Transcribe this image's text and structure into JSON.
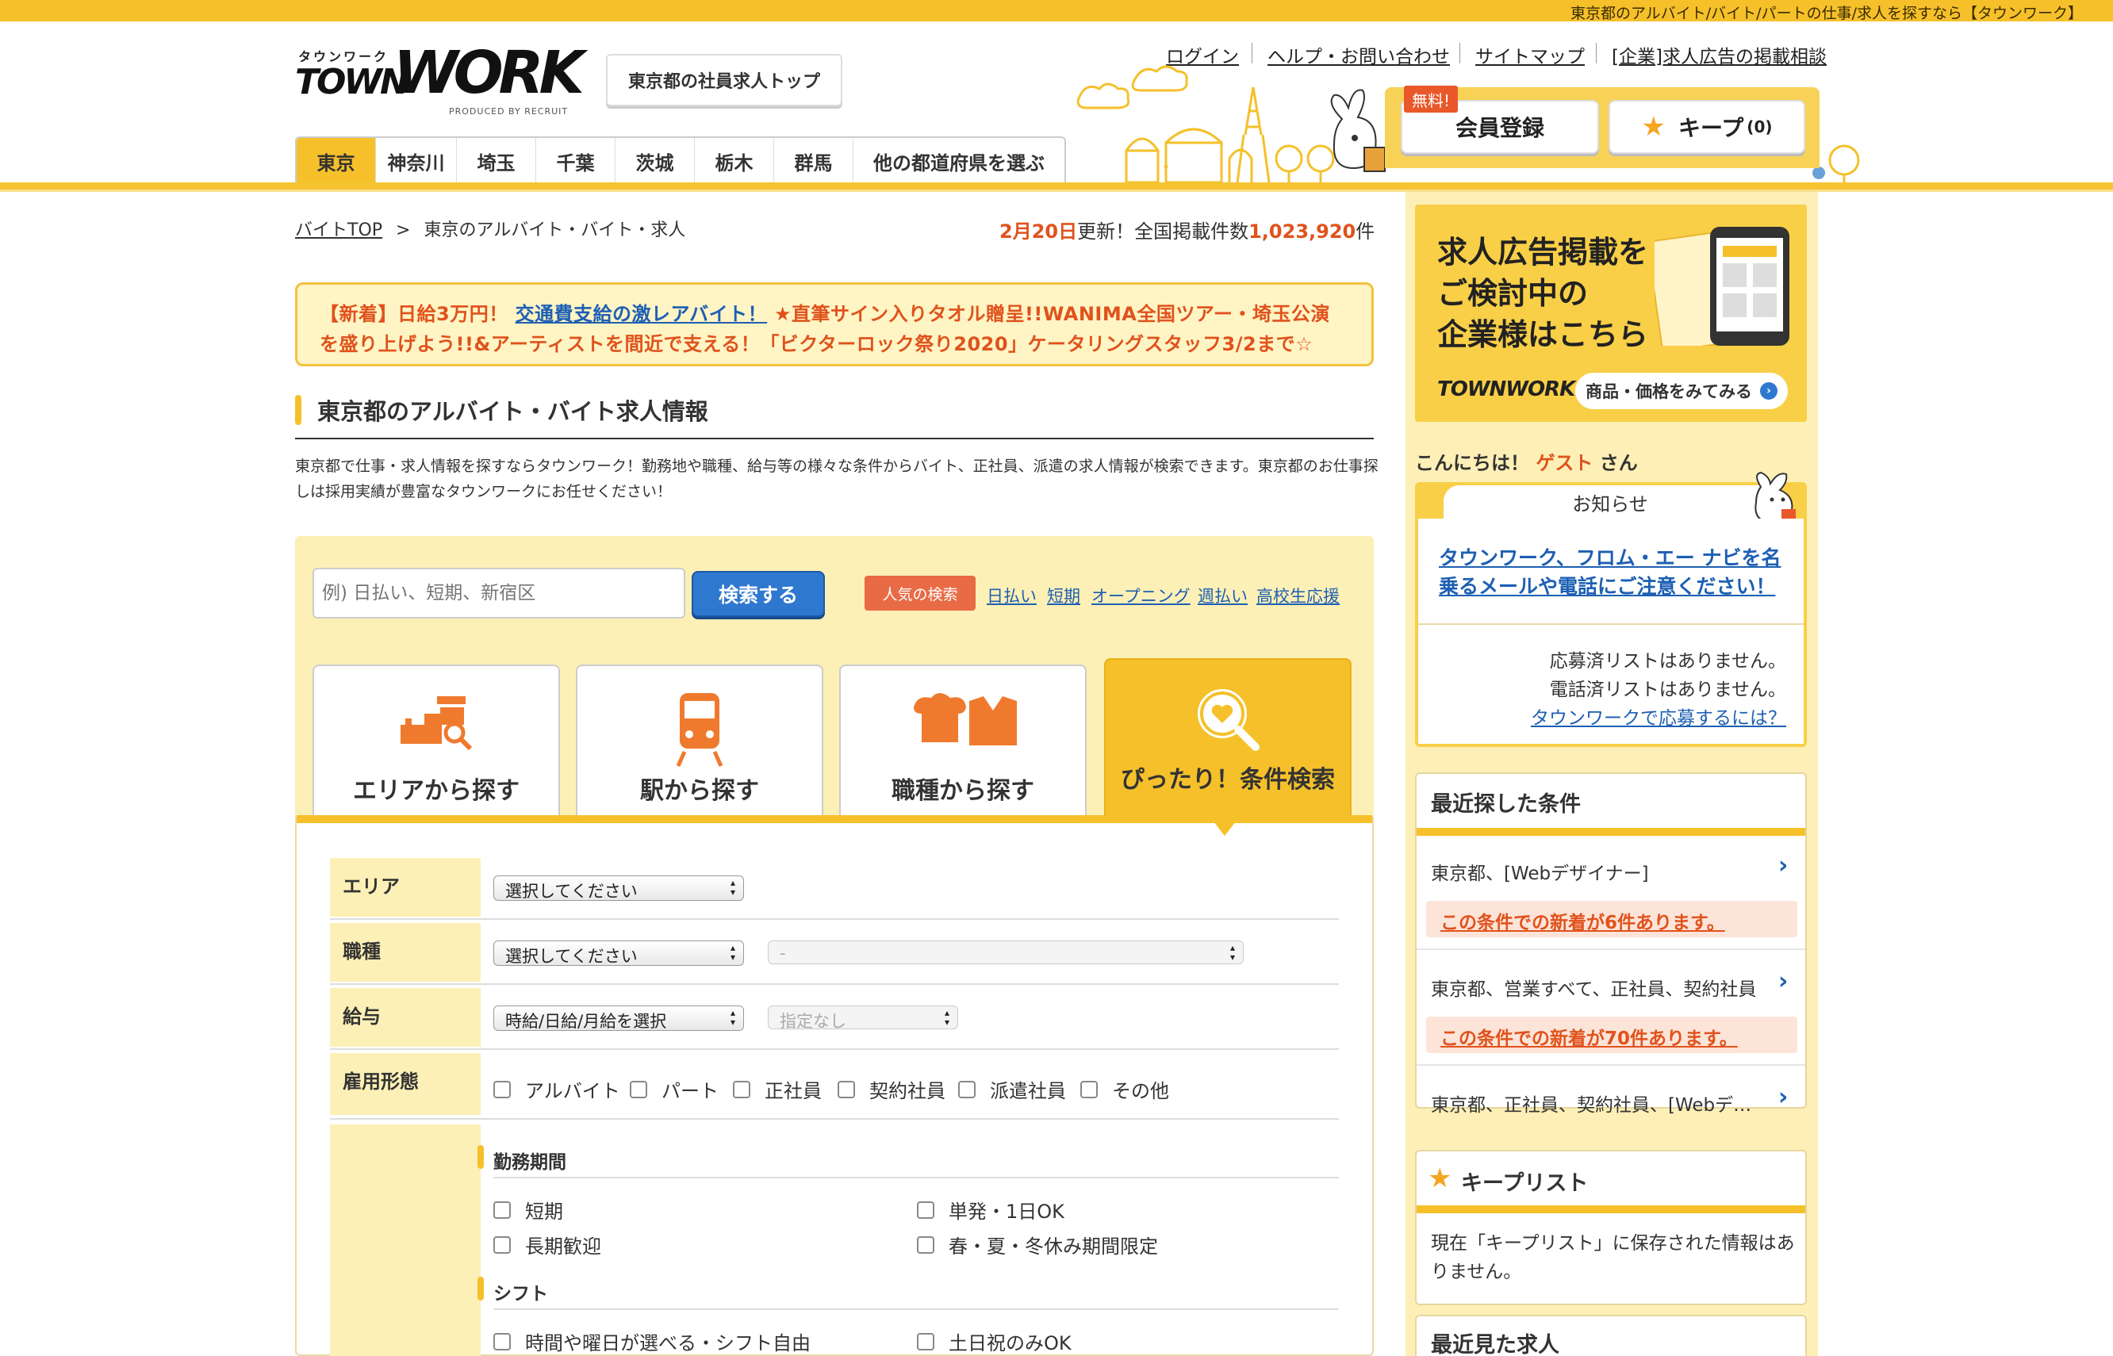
{
  "topbar": {
    "tagline": "東京都のアルバイト/バイト/パートの仕事/求人を探すなら【タウンワーク】"
  },
  "logo": {
    "kana": "タウンワーク",
    "town": "TOWN",
    "work": "WORK",
    "produced": "PRODUCED BY RECRUIT"
  },
  "header": {
    "employee_top_button": "東京都の社員求人トップ",
    "links": [
      "ログイン",
      "ヘルプ・お問い合わせ",
      "サイトマップ",
      "[企業]求人広告の掲載相談"
    ],
    "free_badge": "無料!",
    "register_button": "会員登録",
    "keep_button": "キープ",
    "keep_count": "(0)"
  },
  "prefectures": [
    "東京",
    "神奈川",
    "埼玉",
    "千葉",
    "茨城",
    "栃木",
    "群馬",
    "他の都道府県を選ぶ"
  ],
  "breadcrumb": {
    "home": "バイトTOP",
    "separator": ">",
    "current": "東京のアルバイト・バイト・求人"
  },
  "updated": {
    "date": "2月20日",
    "text1": "更新！全国掲載件数",
    "count": "1,023,920",
    "unit": "件"
  },
  "notice": {
    "prefix": "【新着】日給3万円！",
    "link": "交通費支給の激レアバイト！",
    "rest": "★直筆サイン入りタオル贈呈!!WANIMA全国ツアー・埼玉公演を盛り上げよう!!&アーティストを間近で支える！「ビクターロック祭り2020」ケータリングスタッフ3/2まで☆"
  },
  "section": {
    "title": "東京都のアルバイト・バイト求人情報",
    "description": "東京都で仕事・求人情報を探すならタウンワーク！勤務地や職種、給与等の様々な条件からバイト、正社員、派遣の求人情報が検索できます。東京都のお仕事探しは採用実績が豊富なタウンワークにお任せください！"
  },
  "search": {
    "placeholder": "例) 日払い、短期、新宿区",
    "button": "検索する",
    "popular_label": "人気の検索",
    "popular": [
      "日払い",
      "短期",
      "オープニング",
      "週払い",
      "高校生応援"
    ]
  },
  "search_tabs": [
    "エリアから探す",
    "駅から探す",
    "職種から探す",
    "ぴったり！条件検索"
  ],
  "form": {
    "area_label": "エリア",
    "area_select": "選択してください",
    "job_label": "職種",
    "job_select": "選択してください",
    "job_sub_select": "-",
    "salary_label": "給与",
    "salary_select": "時給/日給/月給を選択",
    "salary_sub_select": "指定なし",
    "employment_label": "雇用形態",
    "employment": [
      "アルバイト",
      "パート",
      "正社員",
      "契約社員",
      "派遣社員",
      "その他"
    ],
    "period_title": "勤務期間",
    "period": [
      "短期",
      "単発・1日OK",
      "長期歓迎",
      "春・夏・冬休み期間限定"
    ],
    "shift_title": "シフト",
    "shift": [
      "時間や曜日が選べる・シフト自由",
      "土日祝のみOK"
    ]
  },
  "sidebar": {
    "ad_lines": [
      "求人広告掲載を",
      "ご検討中の",
      "企業様はこちら"
    ],
    "ad_button": "商品・価格をみてみる",
    "ad_logo": "TOWNWORK",
    "hello_prefix": "こんにちは！",
    "guest": "ゲスト",
    "hello_suffix": "さん",
    "news_title": "お知らせ",
    "news_link": "タウンワーク、フロム・エー ナビを名乗るメールや電話にご注意ください！",
    "no_applied": "応募済リストはありません。",
    "no_called": "電話済リストはありません。",
    "how_to_apply": "タウンワークで応募するには？",
    "recent_title": "最近探した条件",
    "recent": [
      {
        "text": "東京都、[Webデザイナー]",
        "alert": "この条件での新着が6件あります。"
      },
      {
        "text": "東京都、営業すべて、正社員、契約社員",
        "alert": "この条件での新着が70件あります。"
      },
      {
        "text": "東京都、正社員、契約社員、[Webデ…",
        "alert": ""
      }
    ],
    "keep_title": "キープリスト",
    "keep_empty": "現在「キープリスト」に保存された情報はありません。",
    "recent_jobs_title": "最近見た求人"
  },
  "colors": {
    "brand_yellow": "#f5c02a",
    "accent_orange": "#e0521c",
    "link_blue": "#1d5fb3"
  }
}
